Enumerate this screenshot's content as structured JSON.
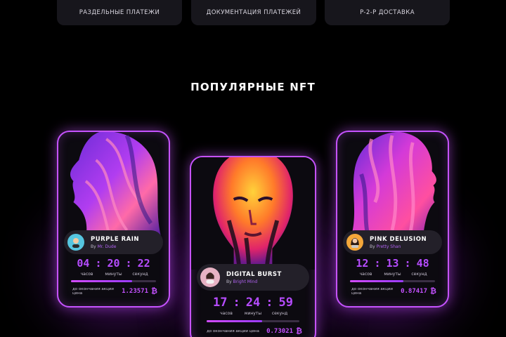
{
  "features": [
    {
      "label": "РАЗДЕЛЬНЫЕ ПЛАТЕЖИ"
    },
    {
      "label": "ДОКУМЕНТАЦИЯ ПЛАТЕЖЕЙ"
    },
    {
      "label": "P-2-P ДОСТАВКА"
    }
  ],
  "section_title": "ПОПУЛЯРНЫЕ NFT",
  "colors": {
    "accent": "#c653ff",
    "timer": "#b64cff",
    "card_bg": "#0c0a10"
  },
  "cards": [
    {
      "name": "PURPLE RAIN",
      "by_prefix": "By",
      "author": "Mr. Dude",
      "timer": {
        "hours": "04",
        "minutes": "20",
        "seconds": "22",
        "sep": ":"
      },
      "units": {
        "hours": "часов",
        "minutes": "минуты",
        "seconds": "секунд"
      },
      "progress": 0.72,
      "price_label": "до окончания акции цена",
      "price": "1.23571",
      "currency_icon": "bitcoin-icon",
      "currency_symbol": "₿"
    },
    {
      "name": "DIGITAL BURST",
      "by_prefix": "By",
      "author": "Bright Mind",
      "timer": {
        "hours": "17",
        "minutes": "24",
        "seconds": "59",
        "sep": ":"
      },
      "units": {
        "hours": "часов",
        "minutes": "минуты",
        "seconds": "секунд"
      },
      "progress": 0.6,
      "price_label": "до окончания акции цена",
      "price": "0.73021",
      "currency_icon": "bitcoin-icon",
      "currency_symbol": "₿"
    },
    {
      "name": "PINK DELUSION",
      "by_prefix": "By",
      "author": "Pretty Shan",
      "timer": {
        "hours": "12",
        "minutes": "13",
        "seconds": "48",
        "sep": ":"
      },
      "units": {
        "hours": "часов",
        "minutes": "минуты",
        "seconds": "секунд"
      },
      "progress": 0.63,
      "price_label": "до окончания акции цена",
      "price": "0.87417",
      "currency_icon": "bitcoin-icon",
      "currency_symbol": "₿"
    }
  ]
}
